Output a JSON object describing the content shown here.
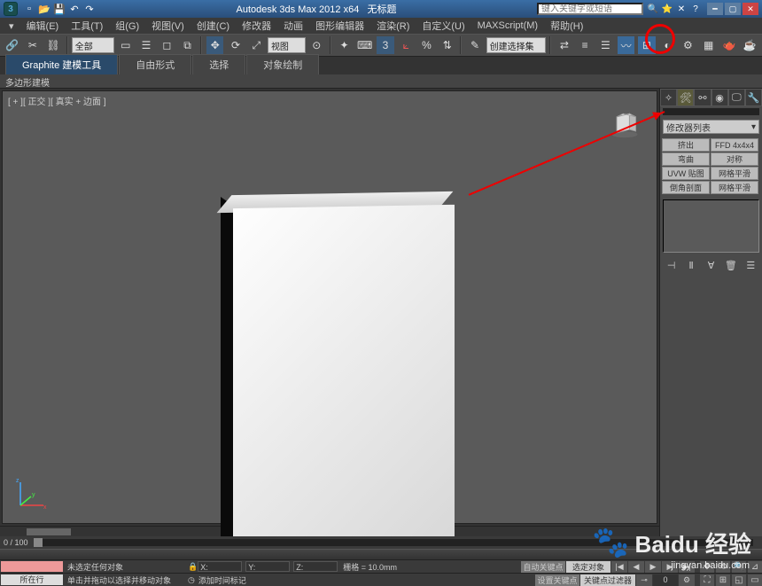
{
  "title": {
    "app": "Autodesk 3ds Max 2012 x64",
    "doc": "无标题",
    "search_placeholder": "键入关键字或短语"
  },
  "menu": {
    "items": [
      "编辑(E)",
      "工具(T)",
      "组(G)",
      "视图(V)",
      "创建(C)",
      "修改器",
      "动画",
      "图形编辑器",
      "渲染(R)",
      "自定义(U)",
      "MAXScript(M)",
      "帮助(H)"
    ]
  },
  "toolbar": {
    "dropdown_all": "全部",
    "dropdown_view": "视图",
    "dropdown_create": "创建选择集"
  },
  "ribbon": {
    "tabs": [
      "Graphite 建模工具",
      "自由形式",
      "选择",
      "对象绘制"
    ],
    "sub": "多边形建模"
  },
  "viewport": {
    "label": "[ + ][ 正交 ][ 真实 + 边面 ]"
  },
  "cmd": {
    "dropdown": "修改器列表",
    "buttons": [
      "挤出",
      "FFD 4x4x4",
      "弯曲",
      "对称",
      "UVW 贴图",
      "网格平滑",
      "倒角剖面",
      "网格平滑"
    ]
  },
  "timeline": {
    "range": "0 / 100"
  },
  "status": {
    "row1_label": "",
    "row1_msg": "未选定任何对象",
    "row2_label": "所在行",
    "row2_msg": "单击并拖动以选择并移动对象",
    "coord_x": "X:",
    "coord_y": "Y:",
    "coord_z": "Z:",
    "grid": "栅格 = 10.0mm",
    "autokey": "自动关键点",
    "selset": "选定对象",
    "setkey": "设置关键点",
    "keyfilter": "关键点过滤器",
    "addtime": "添加时间标记"
  },
  "watermark": {
    "brand": "Baidu 经验",
    "url": "jingyan.baidu.com"
  }
}
